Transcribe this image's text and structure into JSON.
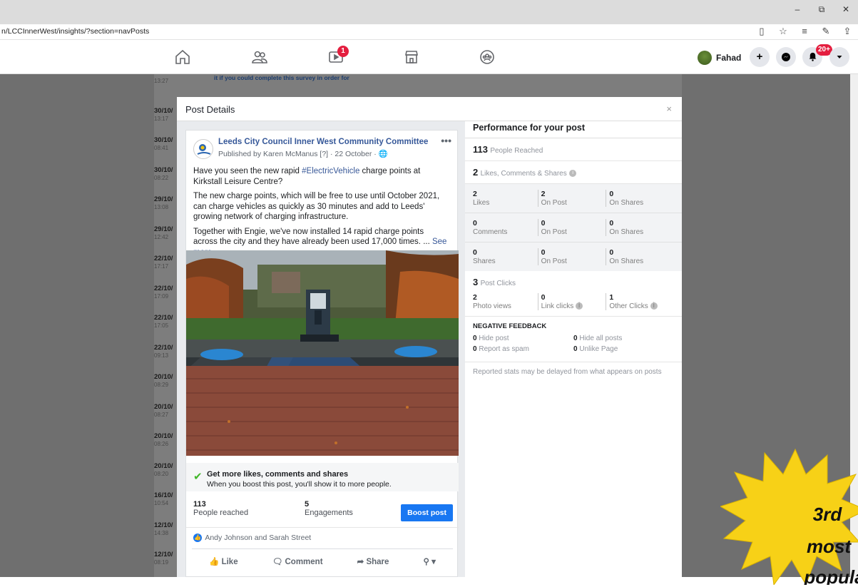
{
  "browser": {
    "url": "n/LCCInnerWest/insights/?section=navPosts",
    "window_controls": {
      "minimize": "–",
      "restore": "⧉",
      "close": "✕"
    }
  },
  "facebook_nav": {
    "video_badge": "1",
    "profile_name": "Fahad",
    "notifications_badge": "20+"
  },
  "background_rows": [
    {
      "date": "",
      "time": "13:27"
    },
    {
      "date": "30/10/",
      "time": "13:17"
    },
    {
      "date": "30/10/",
      "time": "08:41"
    },
    {
      "date": "30/10/",
      "time": "08:22"
    },
    {
      "date": "29/10/",
      "time": "13:08"
    },
    {
      "date": "29/10/",
      "time": "12:42"
    },
    {
      "date": "22/10/",
      "time": "17:17"
    },
    {
      "date": "22/10/",
      "time": "17:09"
    },
    {
      "date": "22/10/",
      "time": "17:05"
    },
    {
      "date": "22/10/",
      "time": "09:13"
    },
    {
      "date": "20/10/",
      "time": "08:29"
    },
    {
      "date": "20/10/",
      "time": "08:27"
    },
    {
      "date": "20/10/",
      "time": "08:26"
    },
    {
      "date": "20/10/",
      "time": "08:20"
    },
    {
      "date": "16/10/",
      "time": "10:54"
    },
    {
      "date": "12/10/",
      "time": "14:38"
    },
    {
      "date": "12/10/",
      "time": "08:19"
    }
  ],
  "background_snippet": "it if you could complete this survey in order for",
  "modal": {
    "title": "Post Details",
    "close": "×"
  },
  "post": {
    "page_name": "Leeds City Council Inner West Community Committee",
    "meta": "Published by Karen McManus [?] · 22 October · ",
    "more": "•••",
    "para1_before": "Have you seen the new rapid ",
    "para1_hashtag": "#ElectricVehicle",
    "para1_after": " charge points at Kirkstall Leisure Centre?",
    "para2": "The new charge points, which will be free to use until October 2021, can charge vehicles as quickly as 30 minutes and add to Leeds' growing network of charging infrastructure.",
    "para3": "Together with Engie, we've now installed 14 rapid charge points across the city and they have already been used 17,000 times. ...",
    "see_more": " See more",
    "boost_title": "Get more likes, comments and shares",
    "boost_sub": "When you boost this post, you'll show it to more people.",
    "people_reached_value": "113",
    "people_reached_label": "People reached",
    "engagements_value": "5",
    "engagements_label": "Engagements",
    "boost_button": "Boost post",
    "reactors": "Andy Johnson and Sarah Street",
    "actions": {
      "like": "Like",
      "comment": "Comment",
      "share": "Share"
    }
  },
  "performance": {
    "title": "Performance for your post",
    "reached_value": "113",
    "reached_label": "People Reached",
    "lcs_value": "2",
    "lcs_label": "Likes, Comments & Shares",
    "rows": [
      [
        {
          "v": "2",
          "l": "Likes"
        },
        {
          "v": "2",
          "l": "On Post"
        },
        {
          "v": "0",
          "l": "On Shares"
        }
      ],
      [
        {
          "v": "0",
          "l": "Comments"
        },
        {
          "v": "0",
          "l": "On Post"
        },
        {
          "v": "0",
          "l": "On Shares"
        }
      ],
      [
        {
          "v": "0",
          "l": "Shares"
        },
        {
          "v": "0",
          "l": "On Post"
        },
        {
          "v": "0",
          "l": "On Shares"
        }
      ]
    ],
    "clicks_value": "3",
    "clicks_label": "Post Clicks",
    "click_cells": [
      {
        "v": "2",
        "l": "Photo views"
      },
      {
        "v": "0",
        "l": "Link clicks"
      },
      {
        "v": "1",
        "l": "Other Clicks"
      }
    ],
    "negative_title": "NEGATIVE FEEDBACK",
    "negative": [
      {
        "v": "0",
        "l": "Hide post"
      },
      {
        "v": "0",
        "l": "Hide all posts"
      },
      {
        "v": "0",
        "l": "Report as spam"
      },
      {
        "v": "0",
        "l": "Unlike Page"
      }
    ],
    "note": "Reported stats may be delayed from what appears on posts"
  },
  "starburst": {
    "line1": "3rd",
    "line2": "most",
    "line3": "popula",
    "color": "#f7d117"
  }
}
